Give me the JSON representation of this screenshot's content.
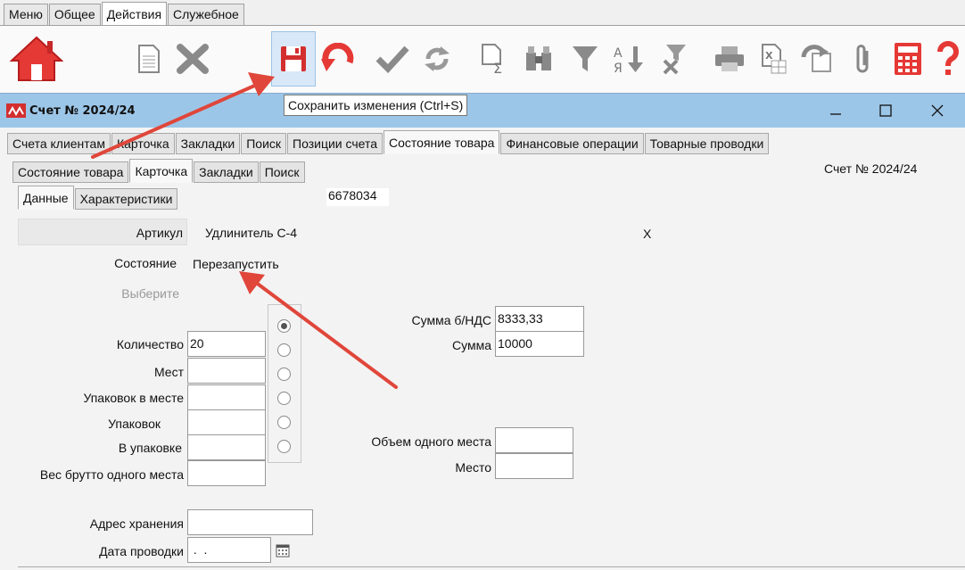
{
  "menu_tabs": [
    "Меню",
    "Общее",
    "Действия",
    "Служебное"
  ],
  "menu_active": 2,
  "toolbar": {
    "tooltip": "Сохранить изменения (Ctrl+S)",
    "icons": [
      "home-icon",
      "new-document-icon",
      "delete-icon",
      "save-icon",
      "undo-icon",
      "check-icon",
      "refresh-icon",
      "sum-icon",
      "binoculars-icon",
      "filter-icon",
      "sort-az-icon",
      "clear-filter-icon",
      "print-icon",
      "excel-icon",
      "export-icon",
      "attach-icon",
      "calculator-icon",
      "help-icon"
    ]
  },
  "window": {
    "title": "Счет № 2024/24",
    "tabs": [
      "Счета клиентам",
      "Карточка",
      "Закладки",
      "Поиск",
      "Позиции счета",
      "Состояние товара",
      "Финансовые операции",
      "Товарные проводки"
    ],
    "active_tab": 5,
    "subtabs": [
      "Состояние товара",
      "Карточка",
      "Закладки",
      "Поиск"
    ],
    "active_subtab": 1,
    "header_right": "Счет № 2024/24",
    "subsubtabs": [
      "Данные",
      "Характеристики"
    ],
    "active_subsubtab": 0,
    "code": "6678034"
  },
  "form": {
    "article_label": "Артикул",
    "article_value": "Удлинитель С-4",
    "article_close": "X",
    "state_label": "Состояние",
    "state_value": "Перезапустить",
    "choose_label": "Выберите",
    "qty_label": "Количество",
    "qty_value": "20",
    "places_label": "Мест",
    "packs_in_place_label": "Упаковок в месте",
    "packs_label": "Упаковок",
    "in_pack_label": "В упаковке",
    "gross_label": "Вес брутто одного места",
    "sum_novat_label": "Сумма  б/НДС",
    "sum_novat_value": "8333,33",
    "sum_label": "Сумма",
    "sum_value": "10000",
    "volume_label": "Объем одного места",
    "place_label": "Место",
    "storage_label": "Адрес хранения",
    "date_label": "Дата проводки",
    "date_value": " .  ."
  },
  "colors": {
    "titlebar": "#9cc6e8",
    "arrow": "#e0463a",
    "home": "#e53935"
  }
}
